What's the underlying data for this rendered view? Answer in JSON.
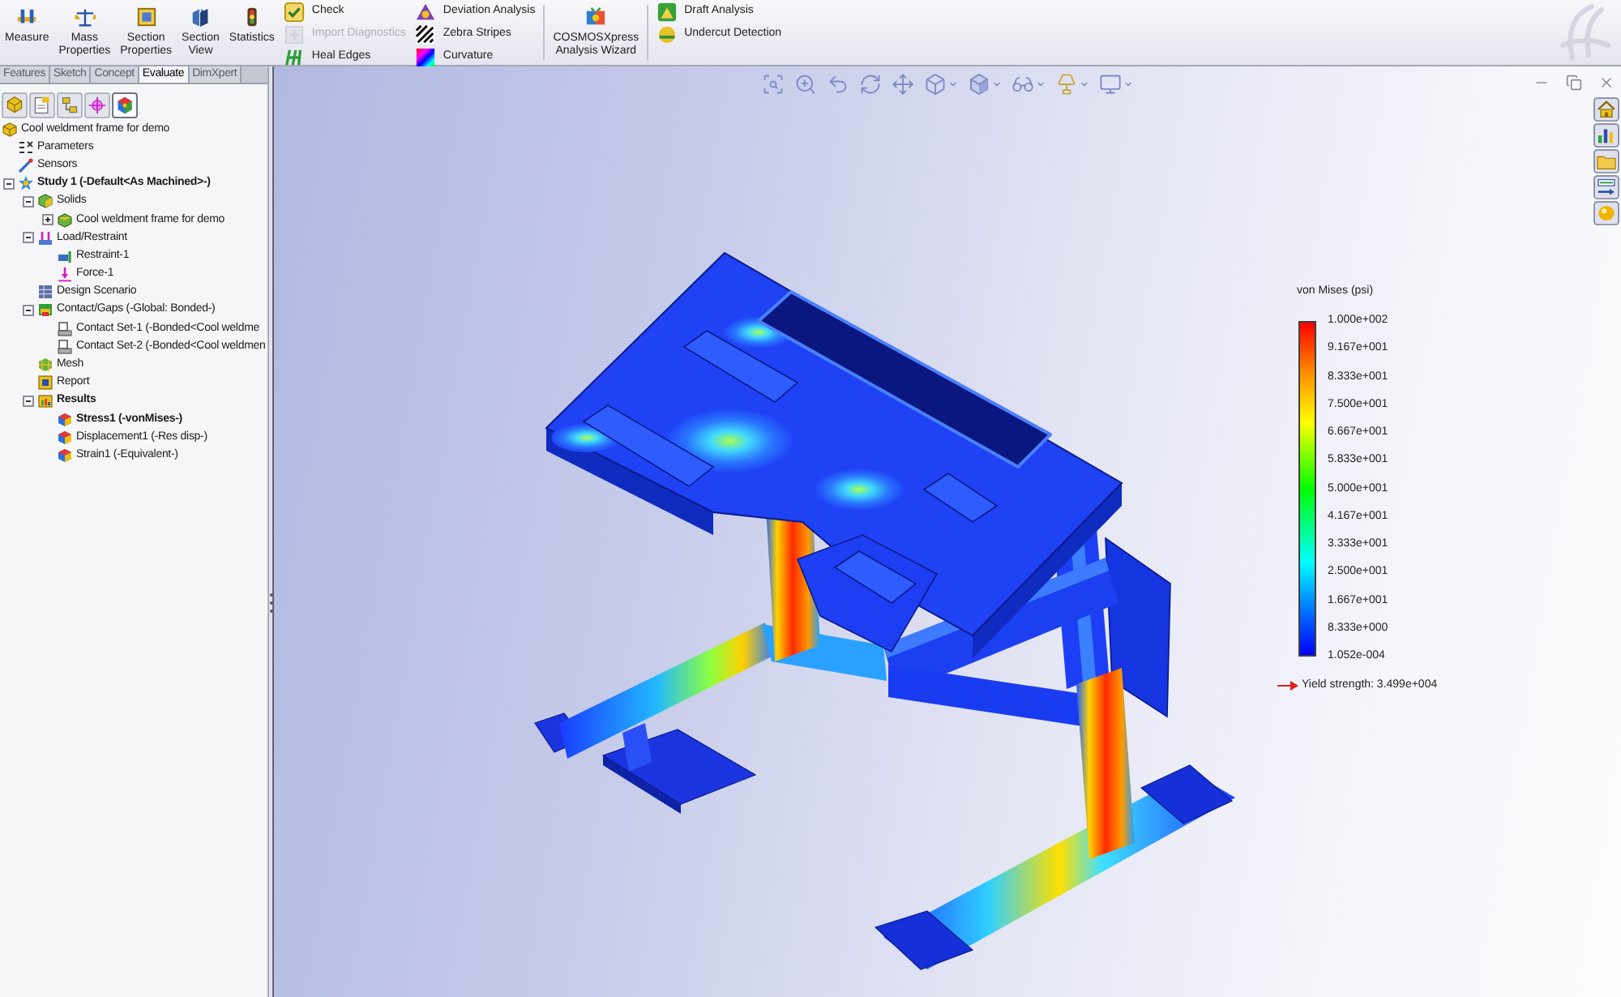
{
  "ribbon": {
    "groups": [
      {
        "kind": "large",
        "divider": false,
        "items": [
          {
            "lines": [
              "Measure"
            ]
          },
          {
            "lines": [
              "Mass",
              "Properties"
            ]
          },
          {
            "lines": [
              "Section",
              "Properties"
            ]
          },
          {
            "lines": [
              "Section",
              "View"
            ]
          },
          {
            "lines": [
              "Statistics"
            ]
          }
        ]
      },
      {
        "kind": "stack",
        "divider": false,
        "items": [
          {
            "label": "Check",
            "disabled": false
          },
          {
            "label": "Import Diagnostics",
            "disabled": true
          },
          {
            "label": "Heal Edges",
            "disabled": false
          }
        ]
      },
      {
        "kind": "stack",
        "divider": false,
        "items": [
          {
            "label": "Deviation Analysis",
            "disabled": false
          },
          {
            "label": "Zebra Stripes",
            "disabled": false
          },
          {
            "label": "Curvature",
            "disabled": false
          }
        ]
      },
      {
        "kind": "large",
        "divider": true,
        "items": [
          {
            "lines": [
              "COSMOSXpress",
              "Analysis Wizard"
            ]
          }
        ]
      },
      {
        "kind": "stack",
        "divider": true,
        "items": [
          {
            "label": "Draft Analysis",
            "disabled": false
          },
          {
            "label": "Undercut Detection",
            "disabled": false
          }
        ]
      }
    ]
  },
  "tabs": [
    {
      "label": "Features",
      "selected": false
    },
    {
      "label": "Sketch",
      "selected": false
    },
    {
      "label": "Concept",
      "selected": false
    },
    {
      "label": "Evaluate",
      "selected": true
    },
    {
      "label": "DimXpert",
      "selected": false
    }
  ],
  "panel_tabs": [
    {
      "selected": false
    },
    {
      "selected": false
    },
    {
      "selected": false
    },
    {
      "selected": false
    },
    {
      "selected": true
    }
  ],
  "tree": [
    {
      "kind": "part",
      "label": "Cool weldment frame for demo",
      "children": [
        {
          "kind": "parameters",
          "label": "Parameters"
        },
        {
          "kind": "sensors",
          "label": "Sensors"
        },
        {
          "kind": "study",
          "label": "Study 1 (-Default<As Machined>-)",
          "bold": true,
          "expanded": true,
          "children": [
            {
              "kind": "solids",
              "label": "Solids",
              "expanded": true,
              "children": [
                {
                  "kind": "solid",
                  "label": "Cool weldment frame for demo",
                  "expanded": false
                }
              ]
            },
            {
              "kind": "loads",
              "label": "Load/Restraint",
              "expanded": true,
              "children": [
                {
                  "kind": "restraint",
                  "label": "Restraint-1"
                },
                {
                  "kind": "force",
                  "label": "Force-1"
                }
              ]
            },
            {
              "kind": "scenario",
              "label": "Design Scenario"
            },
            {
              "kind": "contacts",
              "label": "Contact/Gaps (-Global: Bonded-)",
              "expanded": true,
              "children": [
                {
                  "kind": "contact",
                  "label": "Contact Set-1 (-Bonded<Cool weldme"
                },
                {
                  "kind": "contact",
                  "label": "Contact Set-2 (-Bonded<Cool weldmen"
                }
              ]
            },
            {
              "kind": "mesh",
              "label": "Mesh"
            },
            {
              "kind": "report",
              "label": "Report"
            },
            {
              "kind": "results",
              "label": "Results",
              "bold": true,
              "expanded": true,
              "children": [
                {
                  "kind": "plot",
                  "label": "Stress1 (-vonMises-)",
                  "bold": true
                },
                {
                  "kind": "plot",
                  "label": "Displacement1 (-Res disp-)"
                },
                {
                  "kind": "plot",
                  "label": "Strain1 (-Equivalent-)"
                }
              ]
            }
          ]
        }
      ]
    }
  ],
  "legend": {
    "title": "von Mises (psi)",
    "labels": [
      "1.000e+002",
      "9.167e+001",
      "8.333e+001",
      "7.500e+001",
      "6.667e+001",
      "5.833e+001",
      "5.000e+001",
      "4.167e+001",
      "3.333e+001",
      "2.500e+001",
      "1.667e+001",
      "8.333e+000",
      "1.052e-004"
    ],
    "yield": "Yield strength: 3.499e+004"
  }
}
